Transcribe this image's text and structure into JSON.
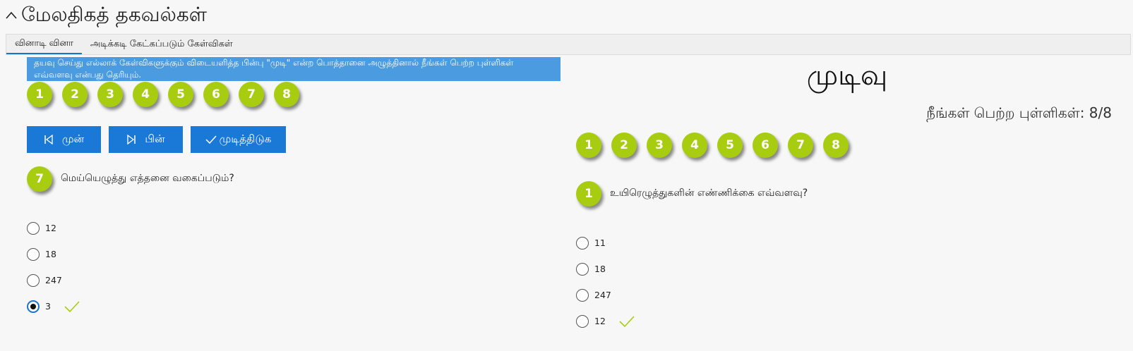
{
  "header": {
    "title": "மேலதிகத் தகவல்கள்"
  },
  "tabs": [
    {
      "label": "வினாடி வினா",
      "active": true
    },
    {
      "label": "அடிக்கடி கேட்கப்படும் கேள்விகள்",
      "active": false
    }
  ],
  "quiz": {
    "notice": "தயவு செய்து எல்லாக் கேள்விகளுக்கும் விடையளித்த பின்பு \"முடி\" என்ற பொத்தானை அழுத்தினால் நீங்கள் பெற்ற புள்ளிகள் எவ்வளவு என்பது தெரியும்.",
    "question_numbers": [
      "1",
      "2",
      "3",
      "4",
      "5",
      "6",
      "7",
      "8"
    ],
    "buttons": {
      "prev": "முன்",
      "next": "பின்",
      "finish": "முடித்திடுக"
    },
    "current_number": "7",
    "question": "மெய்யெழுத்து எத்தனை வகைப்படும்?",
    "options": [
      "12",
      "18",
      "247",
      "3"
    ],
    "selected_index": 3
  },
  "result": {
    "title": "முடிவு",
    "score_label": "நீங்கள் பெற்ற புள்ளிகள்: 8/8",
    "question_numbers": [
      "1",
      "2",
      "3",
      "4",
      "5",
      "6",
      "7",
      "8"
    ],
    "current_number": "1",
    "question": "உயிரெழுத்துகளின் எண்ணிக்கை எவ்வளவு?",
    "options": [
      "11",
      "18",
      "247",
      "12"
    ],
    "correct_index": 3
  },
  "colors": {
    "accent": "#1a78d6",
    "badge": "#a8cc10",
    "notice": "#4a9be0",
    "check": "#a8cc10"
  }
}
